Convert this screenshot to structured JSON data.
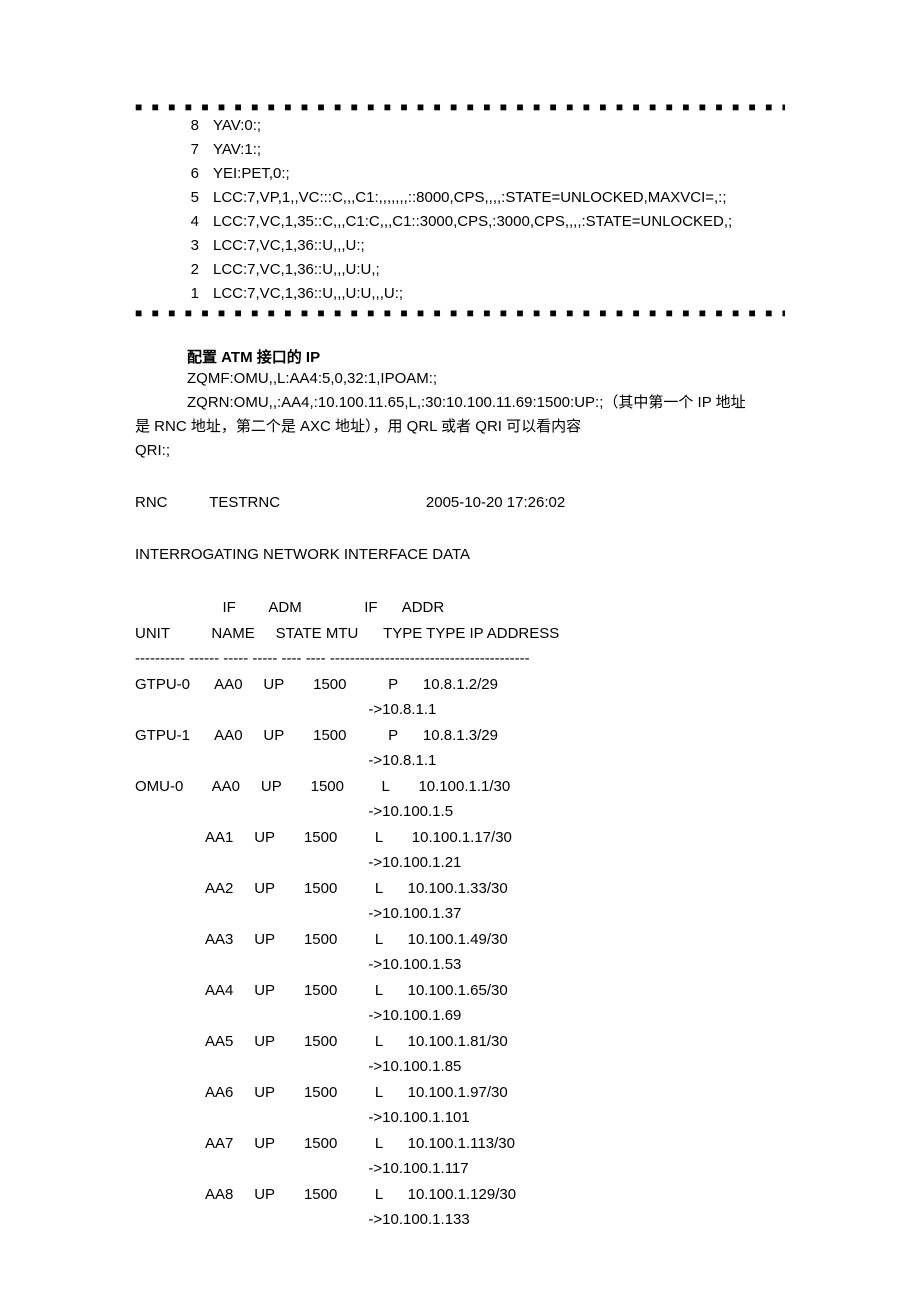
{
  "dotted": "■ ■ ■ ■ ■ ■ ■ ■ ■ ■ ■ ■ ■ ■ ■ ■ ■ ■ ■ ■ ■ ■ ■ ■ ■ ■ ■ ■ ■ ■ ■ ■ ■ ■ ■ ■ ■ ■ ■ ■ ■ ■ ■ ■ ■ ■ ■ ■ ■ ■ ■ ■ ■ ■ ■ ■ ■ ■ ■ ■ ■ ■ ■ ■ ■ ■ ■ ■ ■ ■ ■ ■ ■ ■ ■ ■ ■",
  "commands": [
    {
      "n": "8",
      "t": "YAV:0:;"
    },
    {
      "n": "7",
      "t": "YAV:1:;"
    },
    {
      "n": "6",
      "t": "YEI:PET,0:;"
    },
    {
      "n": "5",
      "t": "LCC:7,VP,1,,VC:::C,,,C1:,,,,,,,::8000,CPS,,,,:STATE=UNLOCKED,MAXVCI=,:;"
    },
    {
      "n": "4",
      "t": "LCC:7,VC,1,35::C,,,C1:C,,,C1::3000,CPS,:3000,CPS,,,,:STATE=UNLOCKED,;"
    },
    {
      "n": "3",
      "t": "LCC:7,VC,1,36::U,,,U:;"
    },
    {
      "n": "2",
      "t": "LCC:7,VC,1,36::U,,,U:U,;"
    },
    {
      "n": "1",
      "t": "LCC:7,VC,1,36::U,,,U:U,,,U:;"
    }
  ],
  "section": {
    "prefix": "配置",
    "bold1": " ATM ",
    "mid": "接口的",
    "bold2": " IP"
  },
  "body": {
    "line1": "ZQMF:OMU,,L:AA4:5,0,32:1,IPOAM:;",
    "line2": "ZQRN:OMU,,:AA4,:10.100.11.65,L,:30:10.100.11.69:1500:UP:;（其中第一个 IP 地址",
    "line3": "是 RNC 地址，第二个是 AXC 地址），用 QRL 或者 QRI 可以看内容",
    "line4": "QRI:;"
  },
  "header": {
    "rnc": "RNC",
    "name": "TESTRNC",
    "datetime": "2005-10-20   17:26:02"
  },
  "tableTitle": "INTERROGATING NETWORK INTERFACE DATA",
  "thead": {
    "r1": "                     IF        ADM               IF      ADDR",
    "r2": "UNIT          NAME     STATE MTU      TYPE TYPE IP ADDRESS",
    "sep": "---------- ------ ----- ----- ---- ---- ----------------------------------------"
  },
  "rows": [
    "GTPU-0      AA0     UP       1500          P      10.8.1.2/29",
    "                                                        ->10.8.1.1",
    "GTPU-1      AA0     UP       1500          P      10.8.1.3/29",
    "                                                        ->10.8.1.1",
    "OMU-0       AA0     UP       1500         L       10.100.1.1/30",
    "                                                        ->10.100.1.5",
    "                 AA1     UP       1500         L       10.100.1.17/30",
    "                                                        ->10.100.1.21",
    "                 AA2     UP       1500         L      10.100.1.33/30",
    "                                                        ->10.100.1.37",
    "                 AA3     UP       1500         L      10.100.1.49/30",
    "                                                        ->10.100.1.53",
    "                 AA4     UP       1500         L      10.100.1.65/30",
    "                                                        ->10.100.1.69",
    "                 AA5     UP       1500         L      10.100.1.81/30",
    "                                                        ->10.100.1.85",
    "                 AA6     UP       1500         L      10.100.1.97/30",
    "                                                        ->10.100.1.101",
    "                 AA7     UP       1500         L      10.100.1.113/30",
    "                                                        ->10.100.1.117",
    "                 AA8     UP       1500         L      10.100.1.129/30",
    "                                                        ->10.100.1.133"
  ]
}
